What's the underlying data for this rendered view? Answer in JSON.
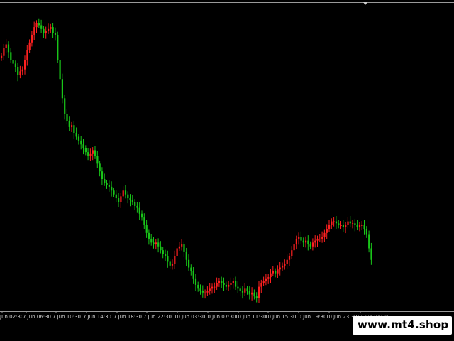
{
  "chart_data": {
    "type": "candlestick",
    "title": "",
    "xlabel": "",
    "ylabel": "",
    "grid": false,
    "colors": {
      "bull": "#ff2020",
      "bear": "#19c519",
      "background": "#000000",
      "axis": "#9a9a9a",
      "hline": "#b0b0b0"
    },
    "x_tick_labels": [
      "Jun 02:30",
      "7 Jun 06:30",
      "7 Jun 10:30",
      "7 Jun 14:30",
      "7 Jun 18:30",
      "7 Jun 22:30",
      "10 Jun 03:30",
      "10 Jun 07:30",
      "10 Jun 11:30",
      "10 Jun 15:30",
      "10 Jun 19:30",
      "10 Jun 23:30",
      "11 Jun 04:30"
    ],
    "period_separators": [
      "7 Jun 22:30",
      "10 Jun 23:30"
    ],
    "horizontal_level_index": 0,
    "close_series": [
      82,
      86,
      88,
      84,
      80,
      78,
      76,
      72,
      74,
      75,
      80,
      85,
      89,
      93,
      97,
      99,
      98,
      96,
      94,
      95,
      96,
      97,
      94,
      93,
      80,
      70,
      60,
      52,
      48,
      45,
      46,
      42,
      40,
      38,
      36,
      34,
      32,
      30,
      31,
      33,
      30,
      26,
      22,
      18,
      16,
      15,
      14,
      12,
      10,
      8,
      6,
      9,
      12,
      10,
      8,
      7,
      6,
      4,
      3,
      0,
      -2,
      -6,
      -10,
      -13,
      -15,
      -16,
      -15,
      -17,
      -19,
      -21,
      -22,
      -25,
      -27,
      -26,
      -22,
      -18,
      -17,
      -16,
      -20,
      -24,
      -28,
      -30,
      -34,
      -37,
      -39,
      -40,
      -41,
      -41,
      -40,
      -39,
      -38,
      -38,
      -36,
      -35,
      -36,
      -37,
      -38,
      -37,
      -36,
      -35,
      -38,
      -39,
      -40,
      -41,
      -39,
      -40,
      -42,
      -41,
      -43,
      -44,
      -38,
      -36,
      -35,
      -34,
      -33,
      -31,
      -30,
      -31,
      -29,
      -28,
      -27,
      -26,
      -24,
      -22,
      -19,
      -16,
      -13,
      -12,
      -14,
      -15,
      -14,
      -16,
      -17,
      -15,
      -14,
      -13,
      -13,
      -12,
      -10,
      -8,
      -6,
      -4,
      -4,
      -5,
      -6,
      -6,
      -7,
      -6,
      -4,
      -5,
      -5,
      -6,
      -7,
      -6,
      -6,
      -8,
      -11,
      -18,
      -24
    ],
    "price_axis_labels": []
  },
  "watermark": {
    "text": "www.mt4.shop"
  }
}
